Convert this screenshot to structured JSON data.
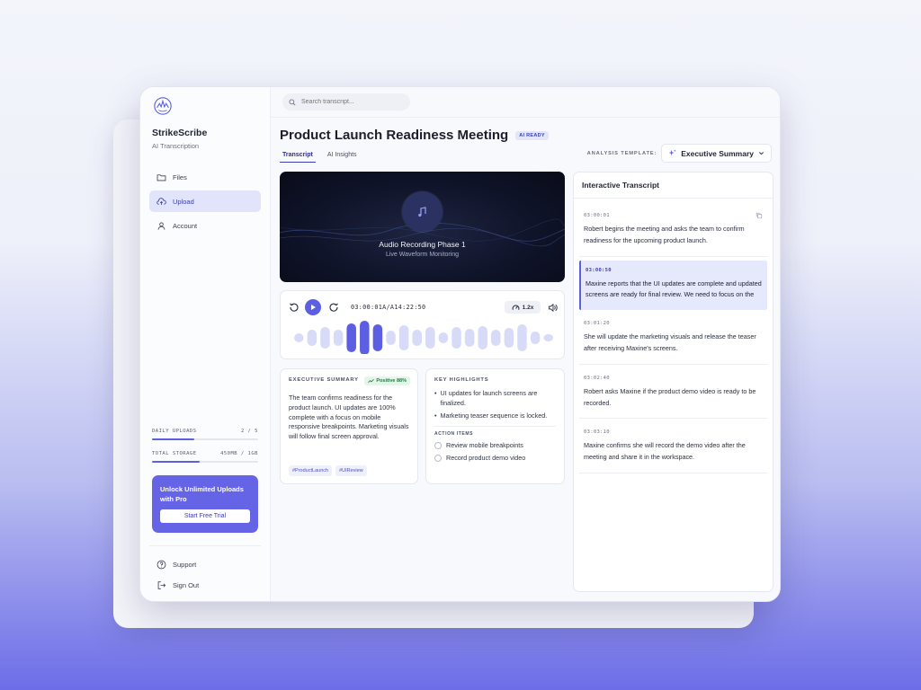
{
  "brand": {
    "name": "StrikeScribe",
    "subtitle": "AI Transcription"
  },
  "nav": {
    "files": "Files",
    "upload": "Upload",
    "account": "Account",
    "support": "Support",
    "sign_out": "Sign Out"
  },
  "usage": {
    "daily_uploads_label": "DAILY UPLOADS",
    "daily_uploads_value": "2 / 5",
    "daily_uploads_fraction": 0.4,
    "storage_label": "TOTAL STORAGE",
    "storage_value": "450MB / 1GB",
    "storage_fraction": 0.45
  },
  "promo": {
    "title": "Unlock Unlimited Uploads with Pro",
    "button": "Start Free Trial"
  },
  "search": {
    "placeholder": "Search transcript..."
  },
  "page": {
    "title": "Product Launch Readiness Meeting",
    "badge": "AI READY",
    "tabs": [
      "Transcript",
      "AI Insights"
    ],
    "template_label": "ANALYSIS TEMPLATE:",
    "template_value": "Executive Summary"
  },
  "video": {
    "title": "Audio Recording Phase 1",
    "subtitle": "Live Waveform Monitoring"
  },
  "player": {
    "timecode": "03:00:01A/A14:22:50",
    "speed": "1.2x",
    "waveform": [
      0.25,
      0.45,
      0.6,
      0.45,
      0.8,
      0.95,
      0.75,
      0.4,
      0.7,
      0.45,
      0.6,
      0.3,
      0.6,
      0.5,
      0.65,
      0.45,
      0.55,
      0.75,
      0.35,
      0.2
    ],
    "waveform_progress": 5
  },
  "summary": {
    "title": "EXECUTIVE SUMMARY",
    "sentiment": "Positive 88%",
    "text": "The team confirms readiness for the product launch. UI updates are 100% complete with a focus on mobile responsive breakpoints. Marketing visuals will follow final screen approval.",
    "tags": [
      "#ProductLaunch",
      "#UIReview"
    ]
  },
  "highlights": {
    "title": "KEY HIGHLIGHTS",
    "items": [
      "UI updates for launch screens are finalized.",
      "Marketing teaser sequence is locked."
    ],
    "actions_title": "ACTION ITEMS",
    "actions": [
      "Review mobile breakpoints",
      "Record product demo video"
    ]
  },
  "transcript": {
    "title": "Interactive Transcript",
    "items": [
      {
        "time": "03:00:01",
        "text": "Robert begins the meeting and asks the team to confirm readiness for the upcoming product launch."
      },
      {
        "time": "03:00:50",
        "text": "Maxine reports that the UI updates are complete and updated screens are ready for final review. We need to focus on the"
      },
      {
        "time": "03:01:20",
        "text": "She will update the marketing visuals and release the teaser after receiving Maxine's screens."
      },
      {
        "time": "03:02:40",
        "text": "Robert asks Maxine if the product demo video is ready to be recorded."
      },
      {
        "time": "03:03:10",
        "text": "Maxine confirms she will record the demo video after the meeting and share it in the workspace."
      }
    ]
  },
  "colors": {
    "accent": "#5d5fe3",
    "promo": "#6664e6",
    "video_bg": "#10142a",
    "positive": "#257a45"
  }
}
